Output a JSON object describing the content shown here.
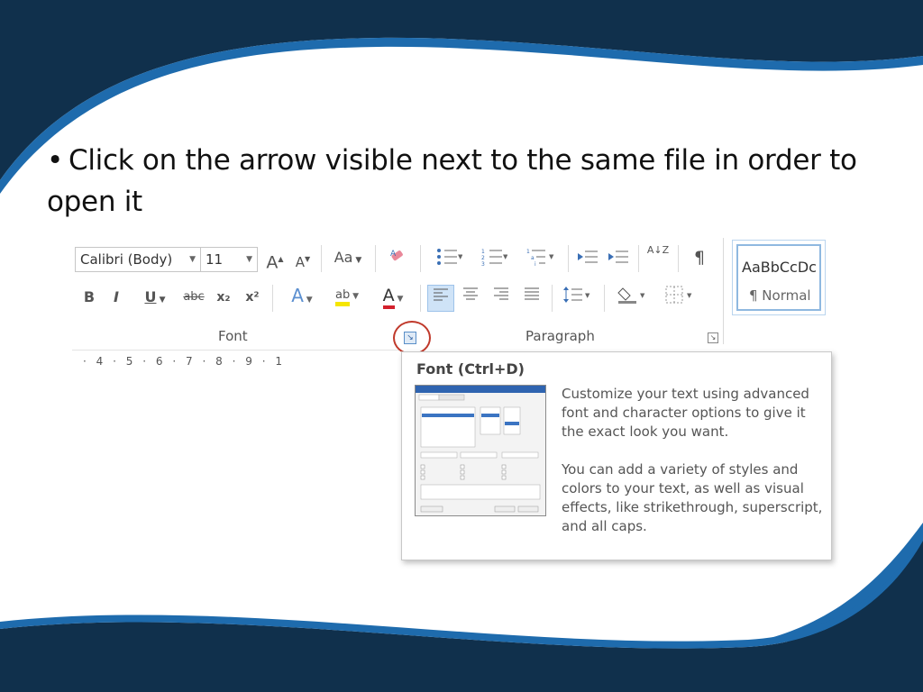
{
  "slide": {
    "bullet_symbol": "•",
    "bullet_text": "Click on the arrow visible next to the same file in order to open it"
  },
  "ribbon": {
    "font_name": "Calibri (Body)",
    "font_size": "11",
    "change_case_label": "Aa",
    "style_preview": "AaBbCcDc",
    "style_name": "¶ Normal",
    "font_group_label": "Font",
    "paragraph_group_label": "Paragraph",
    "buttons": {
      "bold": "B",
      "italic": "I",
      "underline": "U",
      "strikethrough": "abc",
      "subscript": "x₂",
      "superscript": "x²",
      "text_effects": "A",
      "highlight": "ab",
      "font_color": "A",
      "grow_font": "A",
      "shrink_font": "A",
      "pilcrow": "¶",
      "sort": "A↓Z"
    }
  },
  "ruler": {
    "ticks": [
      "·",
      "4",
      "·",
      "5",
      "·",
      "6",
      "·",
      "7",
      "·",
      "8",
      "·",
      "9",
      "·",
      "1"
    ]
  },
  "tooltip": {
    "title": "Font (Ctrl+D)",
    "para1": "Customize your text using advanced font and character options to give it the exact look you want.",
    "para2": "You can add a variety of styles and colors to your text, as well as visual effects, like strikethrough, superscript, and all caps."
  },
  "colors": {
    "dark_navy": "#10304c",
    "accent_blue": "#1e6bad",
    "highlight_circle": "#c0392b"
  }
}
